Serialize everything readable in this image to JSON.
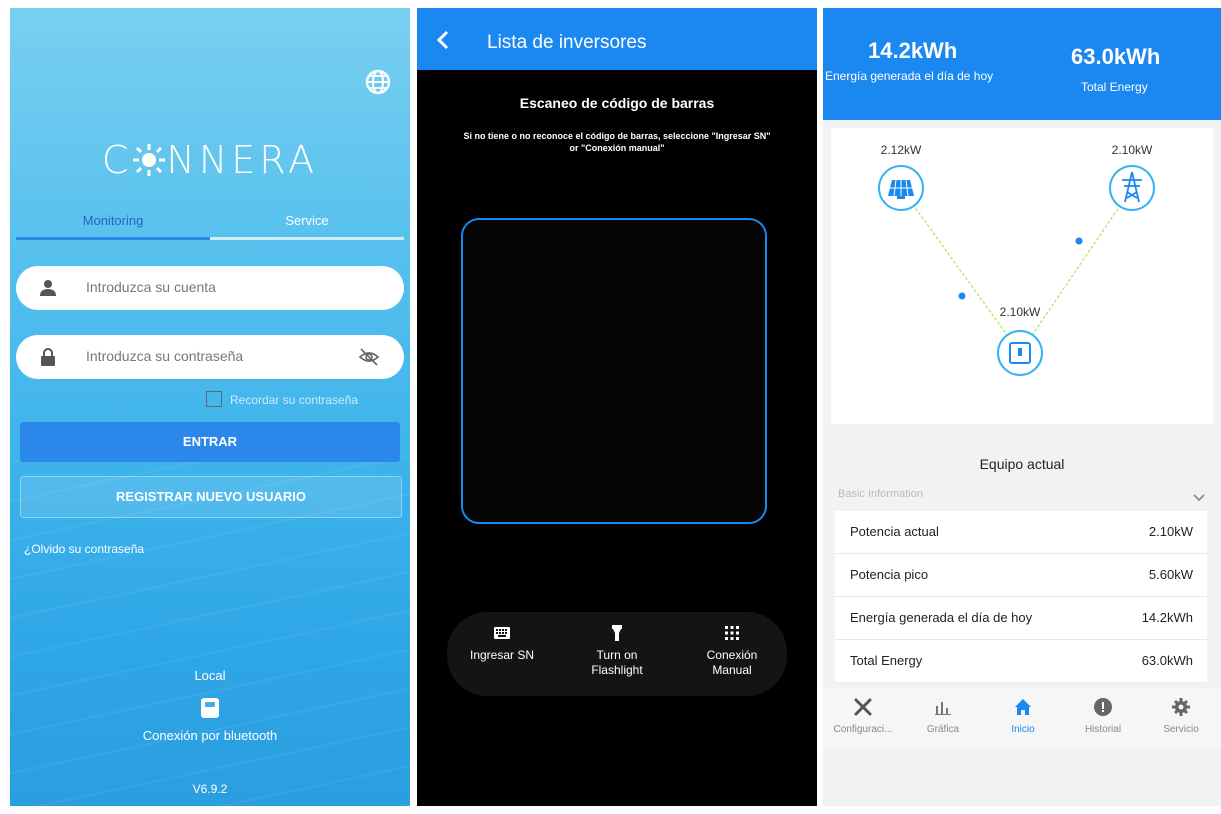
{
  "login": {
    "brand": "C NNERA",
    "tabs": [
      "Monitoring",
      "Service"
    ],
    "account_placeholder": "Introduzca su cuenta",
    "password_placeholder": "Introduzca su contraseña",
    "remember_label": "Recordar su contraseña",
    "enter_label": "ENTRAR",
    "register_label": "REGISTRAR NUEVO USUARIO",
    "forgot_label": "¿Olvido su contraseña",
    "local_label": "Local",
    "bluetooth_label": "Conexión por bluetooth",
    "version": "V6.9.2",
    "colors": {
      "active_tab": "#2266c8",
      "button": "#2b87ea"
    }
  },
  "scanner": {
    "header_title": "Lista de inversores",
    "scan_title": "Escaneo de código de barras",
    "scan_desc_line1": "Si no tiene o no reconoce el código de barras, seleccione \"Ingresar SN\"",
    "scan_desc_line2": "or \"Conexión manual\"",
    "actions": [
      {
        "label": "Ingresar SN",
        "icon": "keyboard-icon"
      },
      {
        "label_line1": "Turn on",
        "label_line2": "Flashlight",
        "icon": "flashlight-icon"
      },
      {
        "label_line1": "Conexión",
        "label_line2": "Manual",
        "icon": "grid-icon"
      }
    ],
    "colors": {
      "header": "#1a88f0",
      "frame": "#1a88f0"
    }
  },
  "dashboard": {
    "today_value": "14.2kWh",
    "today_label": "Energía generada el día de hoy",
    "total_value": "63.0kWh",
    "total_label": "Total Energy",
    "flow": {
      "pv": "2.12kW",
      "grid": "2.10kW",
      "inverter": "2.10kW"
    },
    "section_title": "Equipo actual",
    "basic_info": "Basic Information",
    "rows": [
      {
        "label": "Potencia actual",
        "value": "2.10kW"
      },
      {
        "label": "Potencia pico",
        "value": "5.60kW"
      },
      {
        "label": "Energía generada el día de hoy",
        "value": "14.2kWh"
      },
      {
        "label": "Total Energy",
        "value": "63.0kWh"
      }
    ],
    "nav": [
      "Configuraci...",
      "Gráfica",
      "Inicio",
      "Historial",
      "Servicio"
    ],
    "active_nav": "Inicio",
    "colors": {
      "header": "#1a88f0",
      "flow_line": "#a6e85c",
      "dot": "#1a88f0"
    }
  }
}
